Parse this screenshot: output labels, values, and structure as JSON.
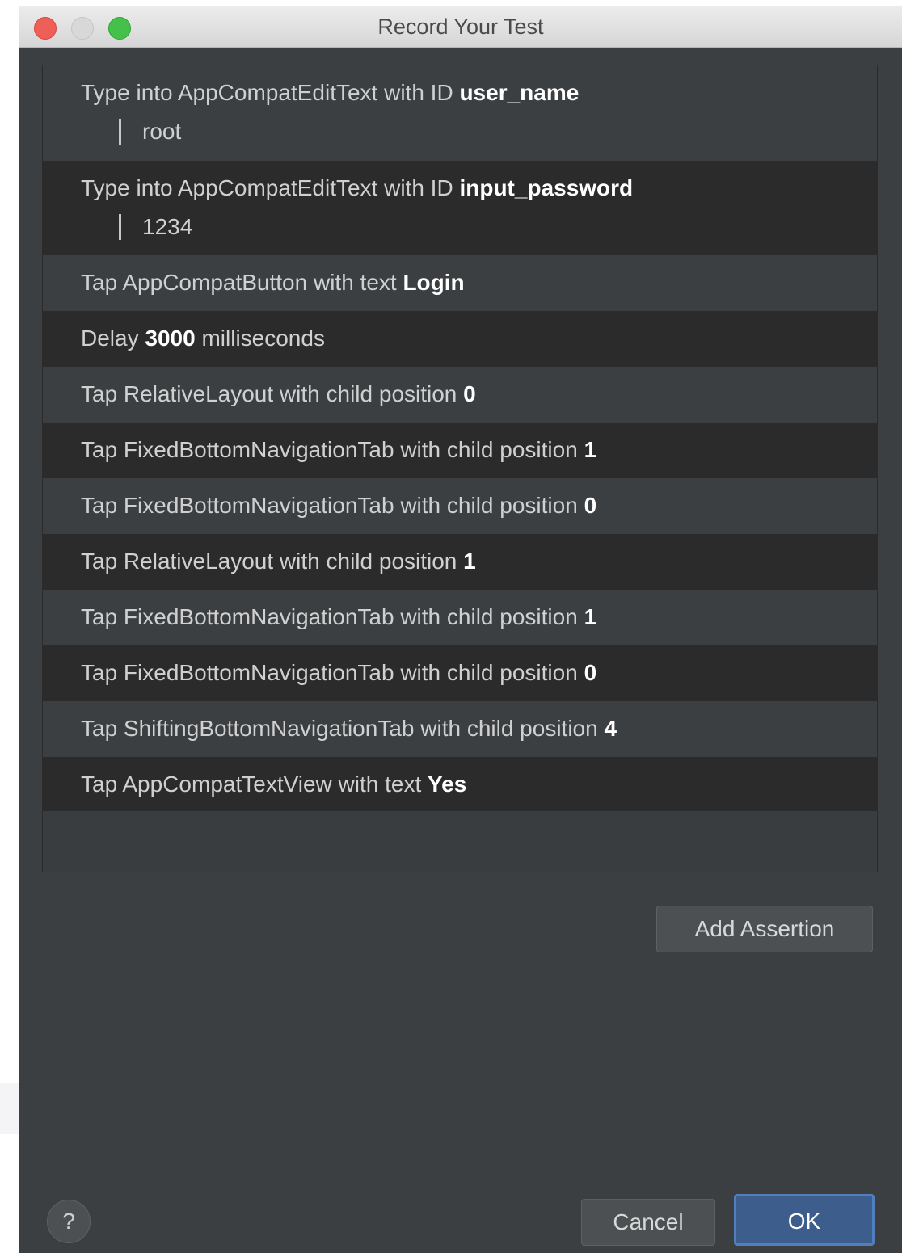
{
  "window": {
    "title": "Record Your Test"
  },
  "steps": [
    {
      "prefix": "Type into AppCompatEditText with ID ",
      "bold": "user_name",
      "value": "root"
    },
    {
      "prefix": "Type into AppCompatEditText with ID ",
      "bold": "input_password",
      "value": "1234"
    },
    {
      "prefix": "Tap AppCompatButton with text ",
      "bold": "Login",
      "suffix": ""
    },
    {
      "prefix": "Delay ",
      "bold": "3000",
      "suffix": " milliseconds"
    },
    {
      "prefix": "Tap RelativeLayout with child position ",
      "bold": "0",
      "suffix": ""
    },
    {
      "prefix": "Tap FixedBottomNavigationTab with child position ",
      "bold": "1",
      "suffix": ""
    },
    {
      "prefix": "Tap FixedBottomNavigationTab with child position ",
      "bold": "0",
      "suffix": ""
    },
    {
      "prefix": "Tap RelativeLayout with child position ",
      "bold": "1",
      "suffix": ""
    },
    {
      "prefix": "Tap FixedBottomNavigationTab with child position ",
      "bold": "1",
      "suffix": ""
    },
    {
      "prefix": "Tap FixedBottomNavigationTab with child position ",
      "bold": "0",
      "suffix": ""
    },
    {
      "prefix": "Tap ShiftingBottomNavigationTab with child position ",
      "bold": "4",
      "suffix": ""
    },
    {
      "prefix": "Tap AppCompatTextView with text ",
      "bold": "Yes",
      "suffix": ""
    }
  ],
  "buttons": {
    "add_assertion": "Add Assertion",
    "cancel": "Cancel",
    "ok": "OK",
    "help": "?"
  },
  "icons": {
    "close": "close-traffic-light",
    "minimize": "minimize-traffic-light",
    "maximize": "maximize-traffic-light",
    "help": "help-icon"
  },
  "colors": {
    "background": "#3c3f41",
    "row_dark": "#2b2b2b",
    "ok_button": "#3d5e8c"
  }
}
